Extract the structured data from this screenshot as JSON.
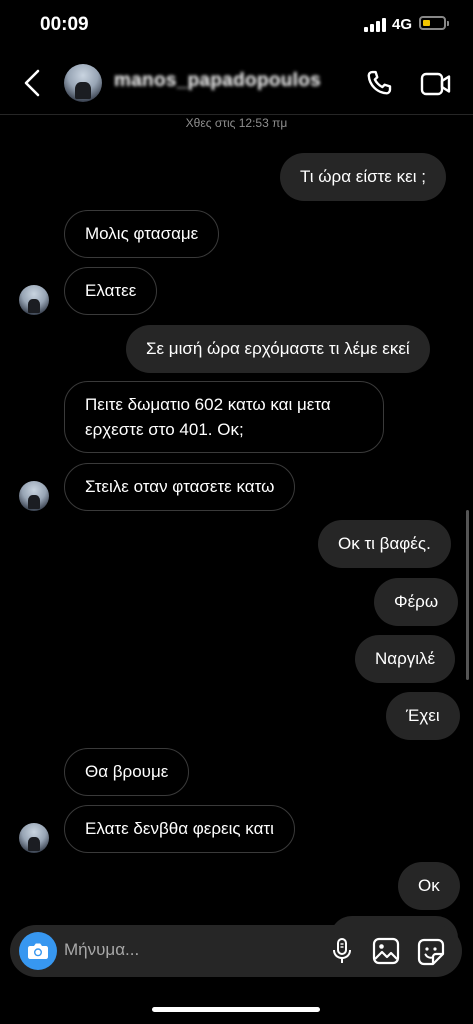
{
  "status": {
    "time": "00:09",
    "network": "4G",
    "battery_level": 0.2
  },
  "header": {
    "username": "manos_papadopoulos"
  },
  "timestamp": "Χθες στις 12:53 πμ",
  "messages": [
    {
      "side": "out",
      "text": "Τι ώρα είστε κει ;"
    },
    {
      "side": "in",
      "text": "Μολις φτασαμε"
    },
    {
      "side": "in",
      "text": "Ελατεε"
    },
    {
      "side": "out",
      "text": "Σε μισή ώρα ερχόμαστε τι λέμε εκεί"
    },
    {
      "side": "in",
      "text": "Πειτε δωματιο 602 κατω και μετα ερχεστε στο 401. Οκ;"
    },
    {
      "side": "in",
      "text": "Στειλε οταν φτασετε κατω"
    },
    {
      "side": "out",
      "text": "Οκ τι βαφές."
    },
    {
      "side": "out",
      "text": "Φέρω"
    },
    {
      "side": "out",
      "text": "Ναργιλέ"
    },
    {
      "side": "out",
      "text": "Έχει"
    },
    {
      "side": "in",
      "text": "Θα βρουμε"
    },
    {
      "side": "in",
      "text": "Ελατε δενβθα φερεις κατι"
    },
    {
      "side": "out",
      "text": "Οκ"
    }
  ],
  "composer": {
    "placeholder": "Μήνυμα..."
  },
  "icons": {
    "back": "chevron-left-icon",
    "call": "phone-icon",
    "video": "video-camera-icon",
    "camera": "camera-icon",
    "mic": "microphone-icon",
    "gallery": "image-icon",
    "sticker": "sticker-icon"
  },
  "colors": {
    "accent": "#3797f0",
    "outgoing_bubble": "#262626",
    "incoming_border": "#3a3a3a"
  }
}
